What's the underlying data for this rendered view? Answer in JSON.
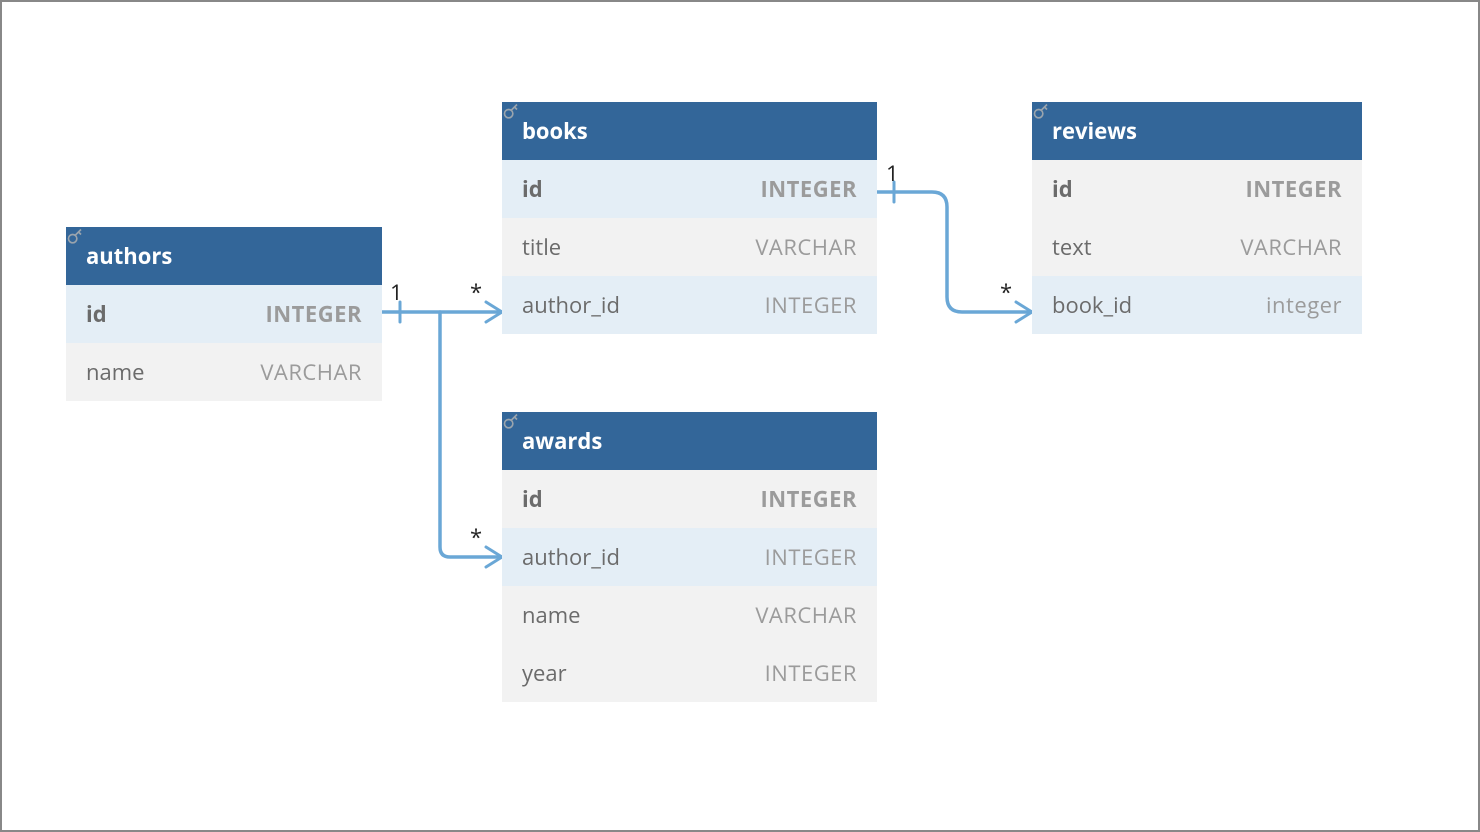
{
  "tables": {
    "authors": {
      "title": "authors",
      "rows": [
        {
          "name": "id",
          "type": "INTEGER",
          "pk": true
        },
        {
          "name": "name",
          "type": "VARCHAR",
          "pk": false
        }
      ]
    },
    "books": {
      "title": "books",
      "rows": [
        {
          "name": "id",
          "type": "INTEGER",
          "pk": true
        },
        {
          "name": "title",
          "type": "VARCHAR",
          "pk": false
        },
        {
          "name": "author_id",
          "type": "INTEGER",
          "pk": false
        }
      ]
    },
    "awards": {
      "title": "awards",
      "rows": [
        {
          "name": "id",
          "type": "INTEGER",
          "pk": true
        },
        {
          "name": "author_id",
          "type": "INTEGER",
          "pk": false
        },
        {
          "name": "name",
          "type": "VARCHAR",
          "pk": false
        },
        {
          "name": "year",
          "type": "INTEGER",
          "pk": false
        }
      ]
    },
    "reviews": {
      "title": "reviews",
      "rows": [
        {
          "name": "id",
          "type": "INTEGER",
          "pk": true
        },
        {
          "name": "text",
          "type": "VARCHAR",
          "pk": false
        },
        {
          "name": "book_id",
          "type": "integer",
          "pk": false
        }
      ]
    }
  },
  "relations": {
    "authors_books": {
      "from_card": "1",
      "to_card": "*"
    },
    "authors_awards": {
      "to_card": "*"
    },
    "books_reviews": {
      "from_card": "1",
      "to_card": "*"
    }
  }
}
